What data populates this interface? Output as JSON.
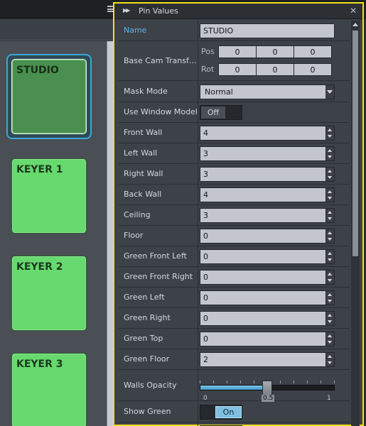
{
  "background": {
    "tiles": [
      {
        "label": "STUDIO",
        "selected": true
      },
      {
        "label": "KEYER 1"
      },
      {
        "label": "KEYER 2"
      },
      {
        "label": "KEYER 3"
      }
    ]
  },
  "dialog": {
    "title": "Pin Values",
    "name": {
      "label": "Name",
      "value": "STUDIO"
    },
    "base_cam": {
      "label": "Base Cam Transf…",
      "pos_label": "Pos",
      "rot_label": "Rot",
      "pos": [
        "0",
        "0",
        "0"
      ],
      "rot": [
        "0",
        "0",
        "0"
      ]
    },
    "mask_mode": {
      "label": "Mask Mode",
      "value": "Normal"
    },
    "use_window_model": {
      "label": "Use Window Model",
      "value": "Off"
    },
    "spins": [
      {
        "label": "Front Wall",
        "value": "4"
      },
      {
        "label": "Left Wall",
        "value": "3"
      },
      {
        "label": "Right Wall",
        "value": "3"
      },
      {
        "label": "Back Wall",
        "value": "4"
      },
      {
        "label": "Ceiling",
        "value": "3"
      },
      {
        "label": "Floor",
        "value": "0"
      },
      {
        "label": "Green Front Left",
        "value": "0"
      },
      {
        "label": "Green Front Right",
        "value": "0"
      },
      {
        "label": "Green Left",
        "value": "0"
      },
      {
        "label": "Green Right",
        "value": "0"
      },
      {
        "label": "Green Top",
        "value": "0"
      },
      {
        "label": "Green Floor",
        "value": "2"
      }
    ],
    "walls_opacity": {
      "label": "Walls Opacity",
      "min": "0",
      "value": "0.5",
      "max": "1",
      "fraction": 0.5
    },
    "show_green": {
      "label": "Show Green",
      "value": "On"
    }
  },
  "colors": {
    "accent": "#5fb8e6",
    "highlight_border": "#f2e21a",
    "tile_green": "#67d96e"
  }
}
